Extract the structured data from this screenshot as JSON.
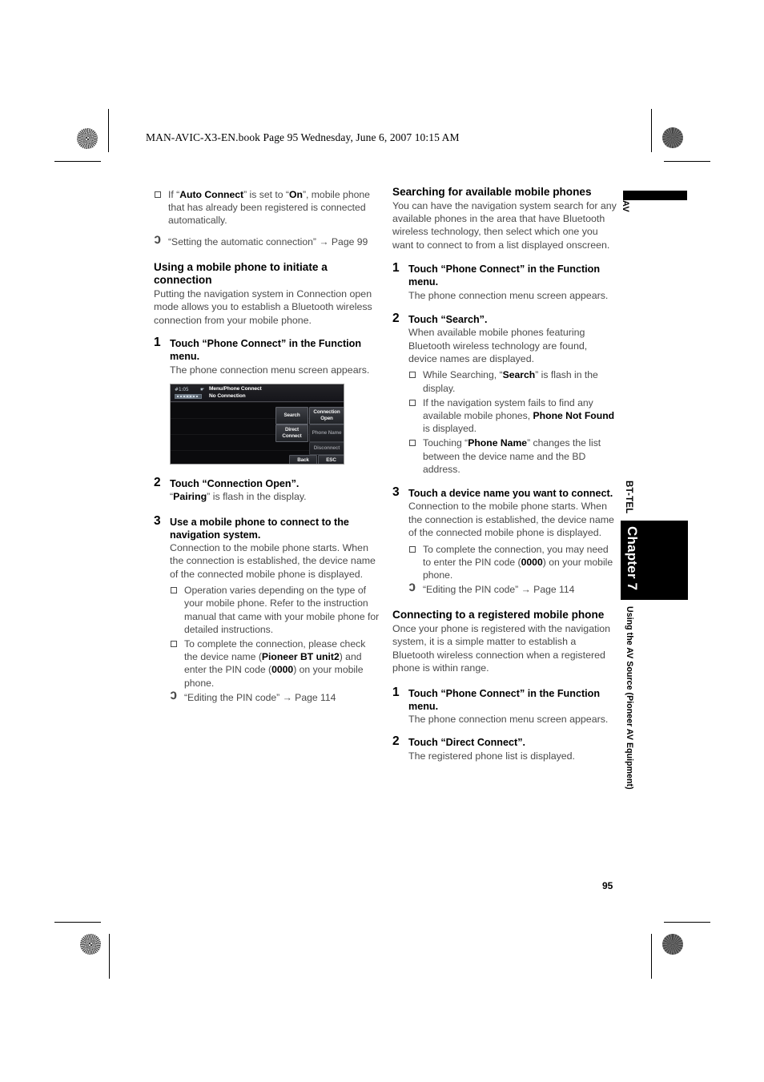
{
  "header": {
    "file_line": "MAN-AVIC-X3-EN.book  Page 95  Wednesday, June 6, 2007  10:15 AM"
  },
  "left_column": {
    "note_auto_connect": {
      "marker": "❑",
      "text_before": "If “",
      "bold1": "Auto Connect",
      "text_mid": "” is set to “",
      "bold2": "On",
      "text_after": "”, mobile phone that has already been registered is connected automatically."
    },
    "ref_auto_connection": {
      "marker": "↪",
      "text": "“Setting the automatic connection” → Page 99"
    },
    "heading": "Using a mobile phone to initiate a connection",
    "intro": "Putting the navigation system in Connection open mode allows you to establish a Bluetooth wireless connection from your mobile phone.",
    "steps": [
      {
        "num": "1",
        "title": "Touch “Phone Connect” in the Function menu.",
        "body": "The phone connection menu screen appears."
      },
      {
        "num": "2",
        "title": "Touch “Connection Open”.",
        "body_before": "“",
        "body_bold": "Pairing",
        "body_after": "” is flash in the display."
      },
      {
        "num": "3",
        "title": "Use a mobile phone to connect to the navigation system.",
        "body": "Connection to the mobile phone starts. When the connection is established, the device name of the connected mobile phone is displayed.",
        "notes": [
          "Operation varies depending on the type of your mobile phone. Refer to the instruction manual that came with your mobile phone for detailed instructions."
        ],
        "note_pin_before": "To complete the connection, please check the device name (",
        "note_pin_bold1": "Pioneer BT unit2",
        "note_pin_mid": ") and enter the PIN code (",
        "note_pin_bold2": "0000",
        "note_pin_after": ") on your mobile phone.",
        "ref": "“Editing the PIN code” → Page 114"
      }
    ]
  },
  "device_screenshot": {
    "clock": "#1:05",
    "bt_icon": "bluetooth-icon",
    "title_line1": "Menu/Phone Connect",
    "title_line2": "No Connection",
    "buttons": [
      {
        "label": "Search",
        "state": "active"
      },
      {
        "label": "Connection Open",
        "state": "active"
      },
      {
        "label": "Direct Connect",
        "state": "active"
      },
      {
        "label": "Phone Name",
        "state": "dimmed"
      },
      {
        "label": "Disconnect",
        "state": "dimmed"
      },
      {
        "label": "Back",
        "state": "active"
      },
      {
        "label": "ESC",
        "state": "active"
      }
    ]
  },
  "right_column": {
    "heading1": "Searching for available mobile phones",
    "intro1": "You can have the navigation system search for any available phones in the area that have Bluetooth wireless technology, then select which one you want to connect to from a list displayed onscreen.",
    "steps1": [
      {
        "num": "1",
        "title": "Touch “Phone Connect” in the Function menu.",
        "body": "The phone connection menu screen appears."
      },
      {
        "num": "2",
        "title": "Touch “Search”.",
        "body": "When available mobile phones featuring Bluetooth wireless technology are found, device names are displayed.",
        "note1_before": "While Searching, “",
        "note1_bold": "Search",
        "note1_after": "” is flash in the display.",
        "note2_before": "If the navigation system fails to find any available mobile phones, ",
        "note2_bold": "Phone Not Found",
        "note2_after": " is displayed.",
        "note3_before": "Touching “",
        "note3_bold": "Phone Name",
        "note3_after": "” changes the list between the device name and the BD address."
      },
      {
        "num": "3",
        "title": "Touch a device name you want to connect.",
        "body": "Connection to the mobile phone starts. When the connection is established, the device name of the connected mobile phone is displayed.",
        "note_before": "To complete the connection, you may need to enter the PIN code (",
        "note_bold": "0000",
        "note_after": ") on your mobile phone.",
        "ref": "“Editing the PIN code” → Page 114"
      }
    ],
    "heading2": "Connecting to a registered mobile phone",
    "intro2": "Once your phone is registered with the navigation system, it is a simple matter to establish a Bluetooth wireless connection when a registered phone is within range.",
    "steps2": [
      {
        "num": "1",
        "title": "Touch “Phone Connect” in the Function menu.",
        "body": "The phone connection menu screen appears."
      },
      {
        "num": "2",
        "title": "Touch “Direct Connect”.",
        "body": "The registered phone list is displayed."
      }
    ]
  },
  "margin": {
    "av_label": "AV",
    "section_tab": "BT-TEL",
    "chapter": "Chapter 7",
    "chapter_subtitle": "Using the AV Source (Pioneer AV Equipment)",
    "page_number": "95"
  }
}
